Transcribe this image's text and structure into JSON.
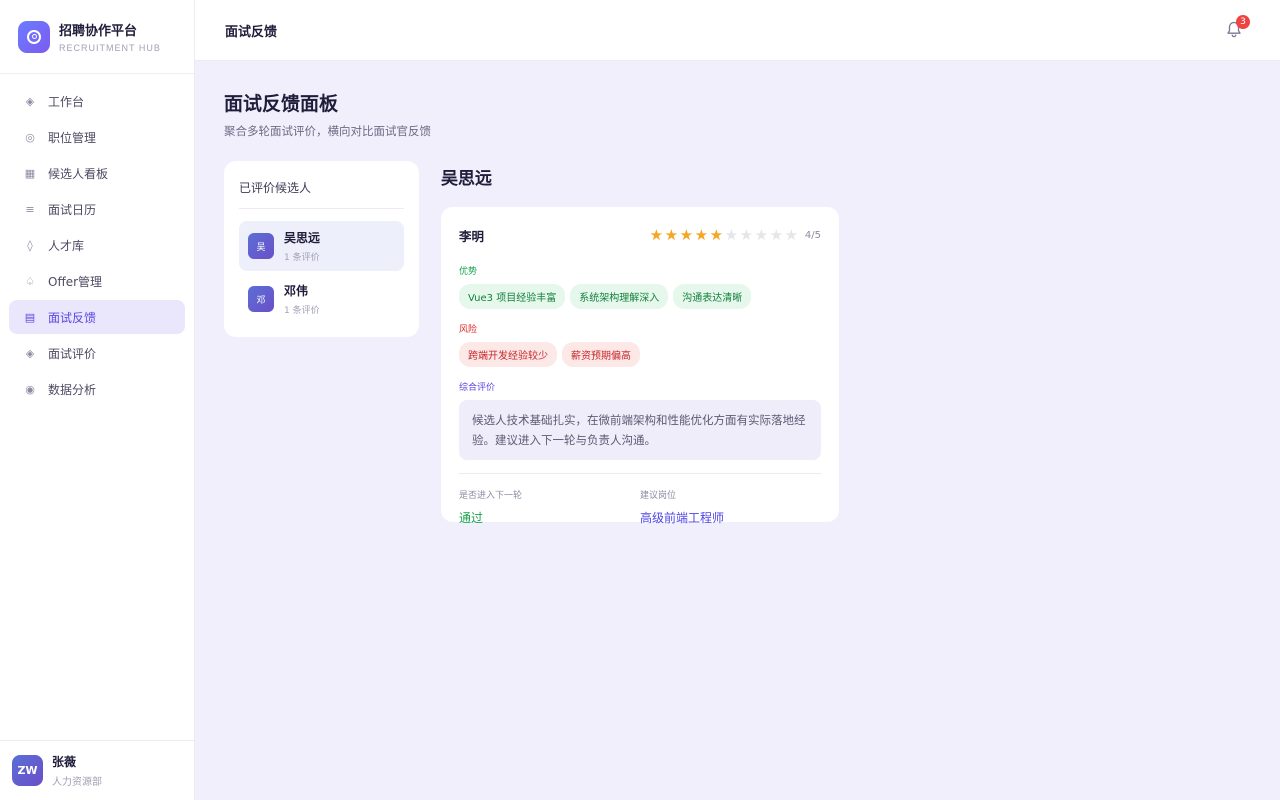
{
  "brand": {
    "name": "招聘协作平台",
    "sub": "RECRUITMENT HUB"
  },
  "sidebar": {
    "items": [
      {
        "label": "工作台",
        "icon": "diamond-icon"
      },
      {
        "label": "职位管理",
        "icon": "target-icon"
      },
      {
        "label": "候选人看板",
        "icon": "grid-icon"
      },
      {
        "label": "面试日历",
        "icon": "list-icon"
      },
      {
        "label": "人才库",
        "icon": "gem-icon"
      },
      {
        "label": "Offer管理",
        "icon": "spade-icon"
      },
      {
        "label": "面试反馈",
        "icon": "feedback-icon",
        "active": true
      },
      {
        "label": "面试评价",
        "icon": "diamond-icon"
      },
      {
        "label": "数据分析",
        "icon": "dot-circle-icon"
      }
    ]
  },
  "user": {
    "initials": "ZW",
    "name": "张薇",
    "dept": "人力资源部"
  },
  "topbar": {
    "title": "面试反馈",
    "notifications": "3"
  },
  "page": {
    "title": "面试反馈面板",
    "subtitle": "聚合多轮面试评价，横向对比面试官反馈"
  },
  "candidates": {
    "title": "已评价候选人",
    "items": [
      {
        "avatar": "吴",
        "name": "吴思远",
        "count": "1 条评价",
        "active": true
      },
      {
        "avatar": "邓",
        "name": "邓伟",
        "count": "1 条评价",
        "active": false
      }
    ]
  },
  "detail": {
    "candidate_name": "吴思远",
    "feedback": {
      "interviewer": "李明",
      "rating": 4,
      "rating_max": 5,
      "score_text": "4/5",
      "strengths_label": "优势",
      "strengths": [
        "Vue3 项目经验丰富",
        "系统架构理解深入",
        "沟通表达清晰"
      ],
      "risks_label": "风险",
      "risks": [
        "跨端开发经验较少",
        "薪资预期偏高"
      ],
      "summary_label": "综合评价",
      "summary": "候选人技术基础扎实，在微前端架构和性能优化方面有实际落地经验。建议进入下一轮与负责人沟通。",
      "next_round_label": "是否进入下一轮",
      "next_round": "通过",
      "position_label": "建议岗位",
      "position": "高级前端工程师"
    }
  },
  "colors": {
    "accent": "#5b47e0",
    "star_on": "#f5a623",
    "star_off": "#e5e5ea",
    "positive": "#16a34a",
    "risk": "#dc2626"
  }
}
